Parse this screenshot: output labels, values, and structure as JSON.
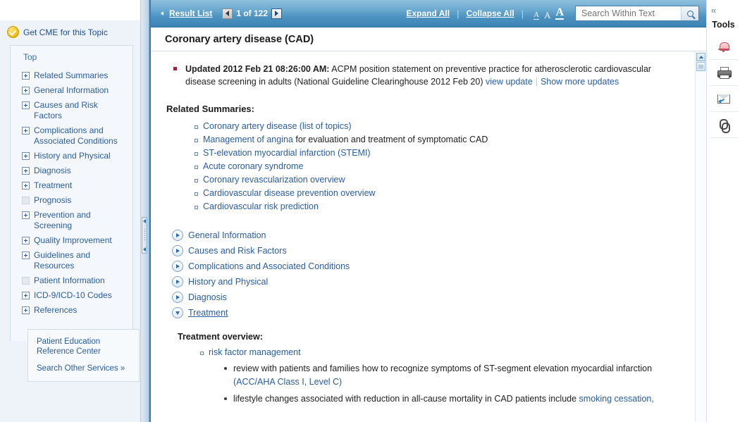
{
  "sidebar": {
    "cme_label": "Get CME for this Topic",
    "nav_top": "Top",
    "items": [
      {
        "label": "Related Summaries",
        "expandable": true
      },
      {
        "label": "General Information",
        "expandable": true
      },
      {
        "label": "Causes and Risk Factors",
        "expandable": true
      },
      {
        "label": "Complications and Associated Conditions",
        "expandable": true
      },
      {
        "label": "History and Physical",
        "expandable": true
      },
      {
        "label": "Diagnosis",
        "expandable": true
      },
      {
        "label": "Treatment",
        "expandable": true
      },
      {
        "label": "Prognosis",
        "expandable": false
      },
      {
        "label": "Prevention and Screening",
        "expandable": true
      },
      {
        "label": "Quality Improvement",
        "expandable": true
      },
      {
        "label": "Guidelines and Resources",
        "expandable": true
      },
      {
        "label": "Patient Information",
        "expandable": false
      },
      {
        "label": "ICD-9/ICD-10 Codes",
        "expandable": true
      },
      {
        "label": "References",
        "expandable": true
      }
    ],
    "promo": {
      "title": "Patient Education Reference Center",
      "link": "Search Other Services »"
    }
  },
  "toolbar": {
    "result_list": "Result List",
    "page_indicator": "1 of 122",
    "expand_all": "Expand All",
    "collapse_all": "Collapse All",
    "separator": "|",
    "font_small": "A",
    "font_medium": "A",
    "font_large": "A",
    "search_placeholder": "Search Within Text",
    "search_value": ""
  },
  "document": {
    "title": "Coronary artery disease (CAD)",
    "update": {
      "prefix": "Updated 2012 Feb 21 08:26:00 AM:",
      "text": " ACPM position statement on preventive practice for atherosclerotic cardiovascular disease screening in adults (National Guideline Clearinghouse 2012 Feb 20) ",
      "view_update": "view update",
      "show_more": "Show more updates"
    },
    "related_summaries_heading": "Related Summaries:",
    "related_summaries": [
      {
        "link": "Coronary artery disease (list of topics)",
        "rest": ""
      },
      {
        "link": "Management of angina",
        "rest": " for evaluation and treatment of symptomatic CAD"
      },
      {
        "link": "ST-elevation myocardial infarction (STEMI)",
        "rest": ""
      },
      {
        "link": "Acute coronary syndrome",
        "rest": ""
      },
      {
        "link": "Coronary revascularization overview",
        "rest": ""
      },
      {
        "link": "Cardiovascular disease prevention overview",
        "rest": ""
      },
      {
        "link": "Cardiovascular risk prediction",
        "rest": ""
      }
    ],
    "sections": [
      {
        "label": "General Information",
        "expanded": false
      },
      {
        "label": "Causes and Risk Factors",
        "expanded": false
      },
      {
        "label": "Complications and Associated Conditions",
        "expanded": false
      },
      {
        "label": "History and Physical",
        "expanded": false
      },
      {
        "label": "Diagnosis",
        "expanded": false
      },
      {
        "label": "Treatment",
        "expanded": true
      }
    ],
    "treatment": {
      "heading": "Treatment overview:",
      "topic_link": "risk factor management",
      "bullet1_a": "review with patients and families how to recognize symptoms of ST-segment elevation myocardial infarction ",
      "bullet1_link": "(ACC/AHA Class I, Level C)",
      "bullet2_a": "lifestyle changes associated with reduction in all-cause mortality in CAD patients include ",
      "bullet2_link": "smoking cessation,"
    }
  },
  "tools": {
    "collapse_glyph": "«",
    "title": "Tools",
    "buttons": [
      {
        "name": "alert-bell"
      },
      {
        "name": "print"
      },
      {
        "name": "email"
      },
      {
        "name": "permalink"
      }
    ]
  }
}
